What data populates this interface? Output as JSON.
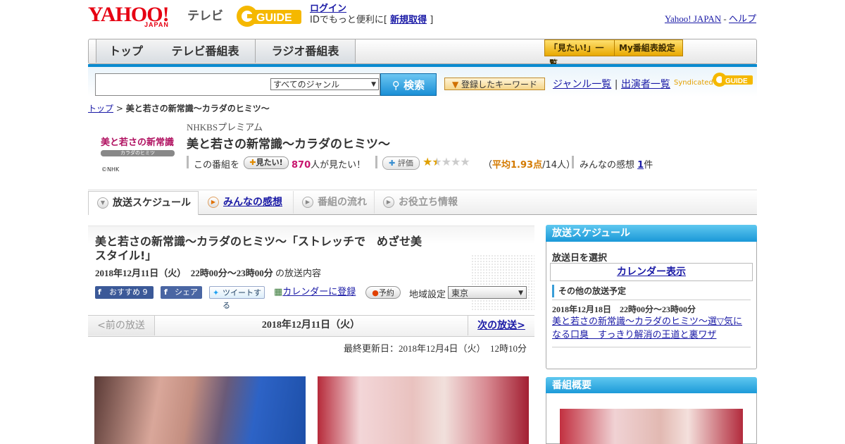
{
  "header": {
    "yahoo_logo": "YAHOO!",
    "yahoo_japan": "JAPAN",
    "service_name": "テレビ",
    "gguide_logo": "GUIDE",
    "login_link": "ログイン",
    "login_prefix": "IDでもっと便利に[",
    "signup_link": "新規取得",
    "login_suffix": "]",
    "yahoo_japan_link": "Yahoo! JAPAN",
    "separator": "-",
    "help_link": "ヘルプ"
  },
  "nav": {
    "tabs": [
      "トップ",
      "テレビ番組表",
      "ラジオ番組表"
    ],
    "mitai_list": "「見たい!」一覧",
    "my_settings": "My番組表設定"
  },
  "search": {
    "genre_selected": "すべてのジャンル",
    "button_label": "検索",
    "keyword_button": "登録したキーワード",
    "genre_list_link": "ジャンル一覧",
    "pipe": "|",
    "performer_list_link": "出演者一覧",
    "syndicated": "Syndicated"
  },
  "breadcrumb": {
    "top": "トップ",
    "sep": ">",
    "current": "美と若さの新常識～カラダのヒミツ～"
  },
  "program": {
    "logo_text": "美と若さの新常識",
    "logo_sub": "カラダのヒミツ",
    "copyright": "©NHK",
    "channel": "NHKBSプレミアム",
    "title": "美と若さの新常識～カラダのヒミツ～",
    "mitai_prefix": "この番組を",
    "mitai_button": "見たい!",
    "mitai_count": "870",
    "mitai_suffix": "人が見たい！",
    "rating_button": "評価",
    "stars_filled": "★",
    "stars_half": "★",
    "stars_empty": "★★★",
    "rating_open": "（",
    "rating_avg": "平均1.93点",
    "rating_count": "/14人）",
    "impressions_label": "みんなの感想",
    "impressions_count": "1",
    "impressions_suffix": "件",
    "rating_value": 1.93
  },
  "tabs": [
    {
      "label": "放送スケジュール",
      "active": true
    },
    {
      "label": "みんなの感想",
      "active": false
    },
    {
      "label": "番組の流れ",
      "active": false
    },
    {
      "label": "お役立ち情報",
      "active": false
    }
  ],
  "episode": {
    "title": "美と若さの新常識～カラダのヒミツ～「ストレッチで　めざせ美スタイル!」",
    "date_bold": "2018年12月11日（火）　22時00分～23時00分",
    "date_suffix": "の放送内容",
    "fb_recommend": "おすすめ 9",
    "fb_share": "シェア",
    "tweet": "ツイートする",
    "calendar_register": "カレンダーに登録",
    "reserve": "予約",
    "area_label": "地域設定",
    "area_value": "東京"
  },
  "pager": {
    "prev": "<前の放送",
    "current": "2018年12月11日（火）",
    "next": "次の放送>"
  },
  "last_updated": "最終更新日：2018年12月4日（火）　12時10分",
  "sidebar": {
    "schedule_title": "放送スケジュール",
    "select_date": "放送日を選択",
    "calendar_link": "カレンダー表示",
    "other_label": "その他の放送予定",
    "other_date": "2018年12月18日　22時00分～23時00分",
    "other_title": "美と若さの新常識～カラダのヒミツ～選▽気になる口臭　すっきり解消の王道と裏ワザ",
    "overview_title": "番組概要"
  },
  "colors": {
    "brand_red": "#e60012",
    "link_blue": "#1a1aa6",
    "accent_blue": "#1a98d8",
    "pink": "#c8166e",
    "orange": "#d47a00"
  }
}
